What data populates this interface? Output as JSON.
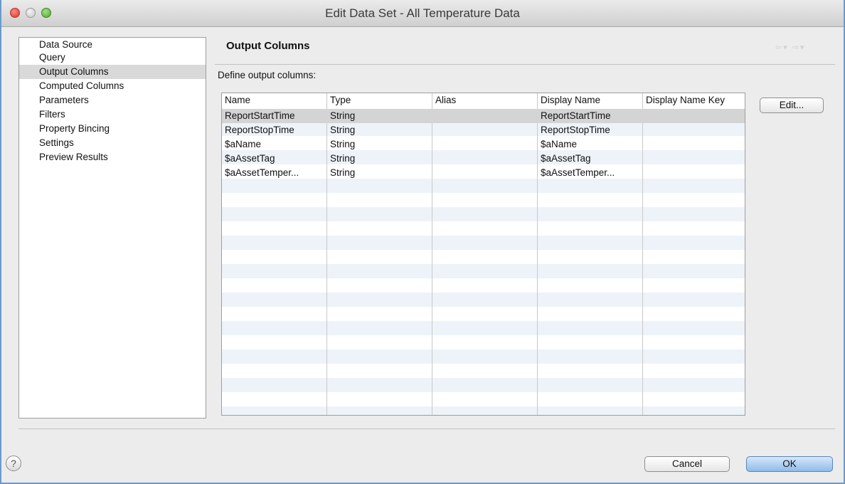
{
  "window": {
    "title": "Edit Data Set - All Temperature Data"
  },
  "sidebar": {
    "items": [
      {
        "label": "Data Source"
      },
      {
        "label": "Query"
      },
      {
        "label": "Output Columns"
      },
      {
        "label": "Computed Columns"
      },
      {
        "label": "Parameters"
      },
      {
        "label": "Filters"
      },
      {
        "label": "Property Bincing"
      },
      {
        "label": "Settings"
      },
      {
        "label": "Preview Results"
      }
    ],
    "selected": "Output Columns"
  },
  "panel": {
    "title": "Output Columns",
    "define_label": "Define output columns:",
    "nav_icons": [
      "back-arrow-icon",
      "forward-arrow-icon"
    ]
  },
  "table": {
    "headers": [
      "Name",
      "Type",
      "Alias",
      "Display Name",
      "Display Name Key"
    ],
    "rows": [
      [
        "ReportStartTime",
        "String",
        "",
        "ReportStartTime",
        ""
      ],
      [
        "ReportStopTime",
        "String",
        "",
        "ReportStopTime",
        ""
      ],
      [
        "$aName",
        "String",
        "",
        "$aName",
        ""
      ],
      [
        "$aAssetTag",
        "String",
        "",
        "$aAssetTag",
        ""
      ],
      [
        "$aAssetTemper...",
        "String",
        "",
        "$aAssetTemper...",
        ""
      ]
    ]
  },
  "buttons": {
    "edit": "Edit...",
    "cancel": "Cancel",
    "ok": "OK"
  },
  "help": {
    "icon": "question-mark-icon",
    "glyph": "?"
  },
  "colors": {
    "window_border": "#6a9acb",
    "selection": "#d4d4d4",
    "stripe": "#eef3fa",
    "ok_button": "#8fbbea"
  }
}
